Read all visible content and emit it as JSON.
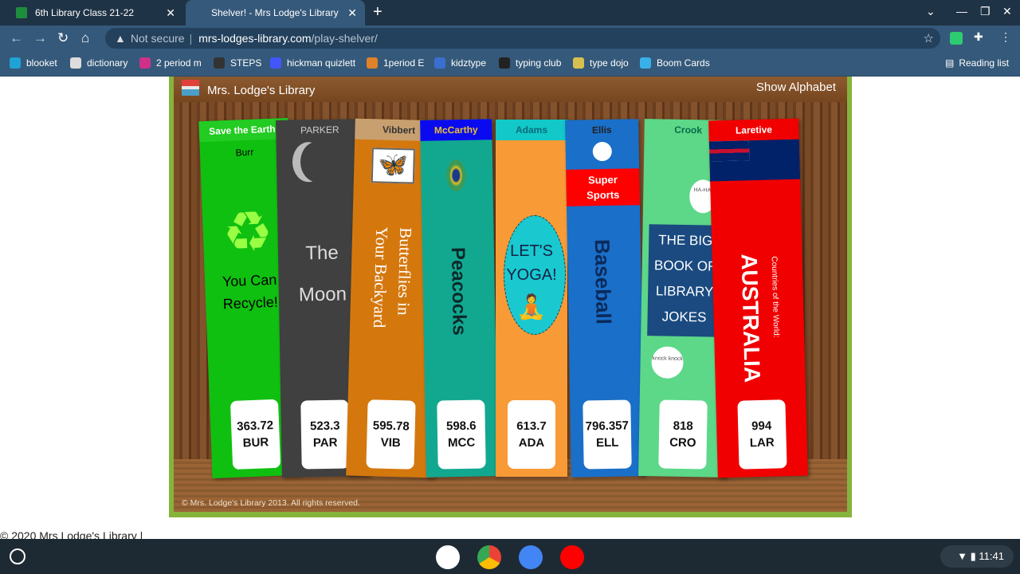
{
  "browser": {
    "tabs": [
      {
        "label": "6th Library Class 21-22",
        "active": false
      },
      {
        "label": "Shelver! - Mrs Lodge's Library",
        "active": true
      }
    ],
    "security": "Not secure",
    "url_domain": "mrs-lodges-library.com",
    "url_path": "/play-shelver/",
    "bookmarks": [
      {
        "label": "blooket",
        "color": "#1fa3d6"
      },
      {
        "label": "dictionary",
        "color": "#ddd"
      },
      {
        "label": "2 period m",
        "color": "#d0308a"
      },
      {
        "label": "STEPS",
        "color": "#333"
      },
      {
        "label": "hickman quizlett",
        "color": "#4255ff"
      },
      {
        "label": "1period E",
        "color": "#e0822a"
      },
      {
        "label": "kidztype",
        "color": "#3a6fd0"
      },
      {
        "label": "typing club",
        "color": "#222"
      },
      {
        "label": "type dojo",
        "color": "#d8c050"
      },
      {
        "label": "Boom Cards",
        "color": "#3ab0e8"
      }
    ],
    "reading_list": "Reading list"
  },
  "game": {
    "site_title": "Mrs. Lodge's Library",
    "show_alphabet": "Show Alphabet",
    "copyright": "© Mrs. Lodge's Library 2013. All rights reserved.",
    "books": [
      {
        "author": "Burr",
        "series": "Save the Earth!",
        "title_lines": [
          "You Can",
          "Recycle!"
        ],
        "call_number": "363.72",
        "call_letters": "BUR",
        "color": "#10c010",
        "image": "recycle-icon"
      },
      {
        "author": "PARKER",
        "title_lines": [
          "The",
          "Moon"
        ],
        "call_number": "523.3",
        "call_letters": "PAR",
        "color": "#404040",
        "image": "moon-icon"
      },
      {
        "author": "Vibbert",
        "title_lines": [
          "Butterflies in",
          "Your Backyard"
        ],
        "call_number": "595.78",
        "call_letters": "VIB",
        "color": "#d4780e",
        "image": "butterfly-icon"
      },
      {
        "author": "McCarthy",
        "title_lines": [
          "Peacocks"
        ],
        "call_number": "598.6",
        "call_letters": "MCC",
        "color": "#12a890",
        "image": "peacock-feather-icon"
      },
      {
        "author": "Adams",
        "title_lines": [
          "LET'S",
          "YOGA!"
        ],
        "call_number": "613.7",
        "call_letters": "ADA",
        "color": "#f89a36",
        "image": "yoga-icon"
      },
      {
        "author": "Ellis",
        "series": "Super Sports",
        "title_lines": [
          "Baseball"
        ],
        "call_number": "796.357",
        "call_letters": "ELL",
        "color": "#1a6fc8",
        "image": "baseball-icon"
      },
      {
        "author": "Crook",
        "title_lines": [
          "THE BIG",
          "BOOK OF",
          "LIBRARY",
          "JOKES"
        ],
        "bubble_top": "HA-HA!",
        "bubble_bottom": "knock knock",
        "call_number": "818",
        "call_letters": "CRO",
        "color": "#5cd888",
        "image": "speech-bubble-icon"
      },
      {
        "author": "Laretive",
        "series": "Countries of the World:",
        "title_lines": [
          "AUSTRALIA"
        ],
        "call_number": "994",
        "call_letters": "LAR",
        "color": "#f00000",
        "image": "australia-flag-icon"
      }
    ]
  },
  "page_footer": "© 2020 Mrs Lodge's Library |",
  "os": {
    "clock": "11:41"
  }
}
